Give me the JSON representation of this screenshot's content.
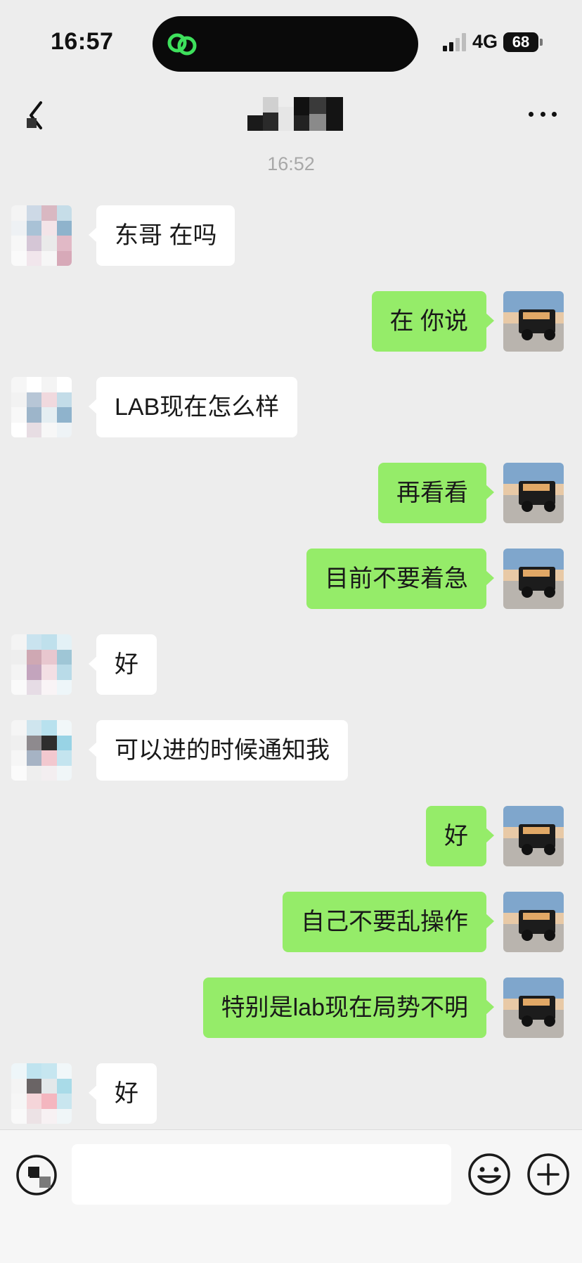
{
  "status_bar": {
    "time": "16:57",
    "network": "4G",
    "battery": "68"
  },
  "nav": {
    "back_icon": "chevron-left-icon",
    "more_icon": "ellipsis-icon"
  },
  "chat": {
    "timestamp": "16:52",
    "messages": [
      {
        "side": "in",
        "text": "东哥 在吗"
      },
      {
        "side": "out",
        "text": "在 你说"
      },
      {
        "side": "in",
        "text": "LAB现在怎么样"
      },
      {
        "side": "out",
        "text": "再看看"
      },
      {
        "side": "out",
        "text": "目前不要着急"
      },
      {
        "side": "in",
        "text": "好"
      },
      {
        "side": "in",
        "text": "可以进的时候通知我"
      },
      {
        "side": "out",
        "text": "好"
      },
      {
        "side": "out",
        "text": "自己不要乱操作"
      },
      {
        "side": "out",
        "text": "特别是lab现在局势不明"
      },
      {
        "side": "in",
        "text": "好"
      }
    ]
  },
  "input_bar": {
    "text_value": "",
    "voice_icon": "voice-icon",
    "emoji_icon": "emoji-icon",
    "plus_icon": "plus-icon"
  },
  "colors": {
    "background": "#ededed",
    "outgoing_bubble": "#95ec69",
    "incoming_bubble": "#ffffff",
    "app_icon_green": "#3ee05c"
  }
}
